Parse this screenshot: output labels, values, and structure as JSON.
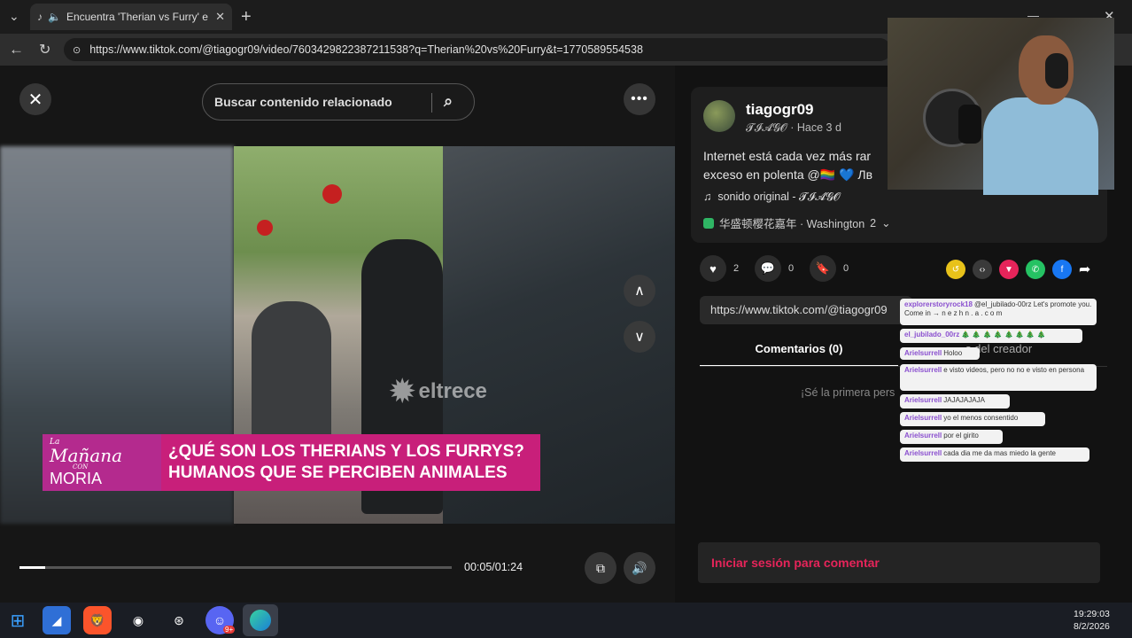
{
  "browser": {
    "tab_title": "Encuentra 'Therian vs Furry' e",
    "url": "https://www.tiktok.com/@tiagogr09/video/7603429822387211538?q=Therian%20vs%20Furry&t=1770589554538"
  },
  "video": {
    "search_placeholder": "Buscar contenido relacionado",
    "watermark": "eltrece",
    "lower_third": {
      "show_line1": "La",
      "show_line2": "Mañana",
      "show_line3": "CON",
      "show_line4": "MORIA",
      "headline_1": "¿QUÉ SON LOS THERIANS Y LOS FURRYS?",
      "headline_2": "HUMANOS QUE SE PERCIBEN ANIMALES"
    },
    "timecode": "00:05/01:24",
    "progress": 0.06
  },
  "post": {
    "username": "tiagogr09",
    "display_name": "𝓣𝓘𝓐𝓖𝓞",
    "age": "Hace 3 d",
    "description": "Internet está cada vez más rar exceso en polenta @🏳️‍🌈 💙 Лв",
    "sound": "sonido original - 𝓣𝓘𝓐𝓖𝓞",
    "location": "华盛顿樱花嘉年 · Washington",
    "location_more": "2",
    "likes": "2",
    "comments": "0",
    "saves": "0",
    "copy_url": "https://www.tiktok.com/@tiagogr09",
    "tab_comments": "Comentarios (0)",
    "tab_creator": "s del creador",
    "first_comment": "¡Sé la primera pers",
    "login": "Iniciar sesión para comentar"
  },
  "chat": [
    {
      "user": "explorerstoryrock18",
      "text": "@el_jubilado-00rz Let's promote you. Come in → n e z h n . a . c o m"
    },
    {
      "user": "el_jubilado_00rz",
      "text": "🎄 🎄 🎄 🎄 🎄 🎄 🎄 🎄"
    },
    {
      "user": "Arielsurrell",
      "text": "Holoo"
    },
    {
      "user": "Arielsurrell",
      "text": "e visto videos, pero no no e visto en persona"
    },
    {
      "user": "Arielsurrell",
      "text": "JAJAJAJAJA"
    },
    {
      "user": "Arielsurrell",
      "text": "yo el menos consentido"
    },
    {
      "user": "Arielsurrell",
      "text": "por el girito"
    },
    {
      "user": "Arielsurrell",
      "text": "cada dia me da mas miedo la gente"
    }
  ],
  "taskbar": {
    "time": "19:29:03",
    "date": "8/2/2026",
    "discord_badge": "9+"
  },
  "colors": {
    "accent_red": "#e6245a",
    "lower_third_pink": "#c81f7a"
  }
}
